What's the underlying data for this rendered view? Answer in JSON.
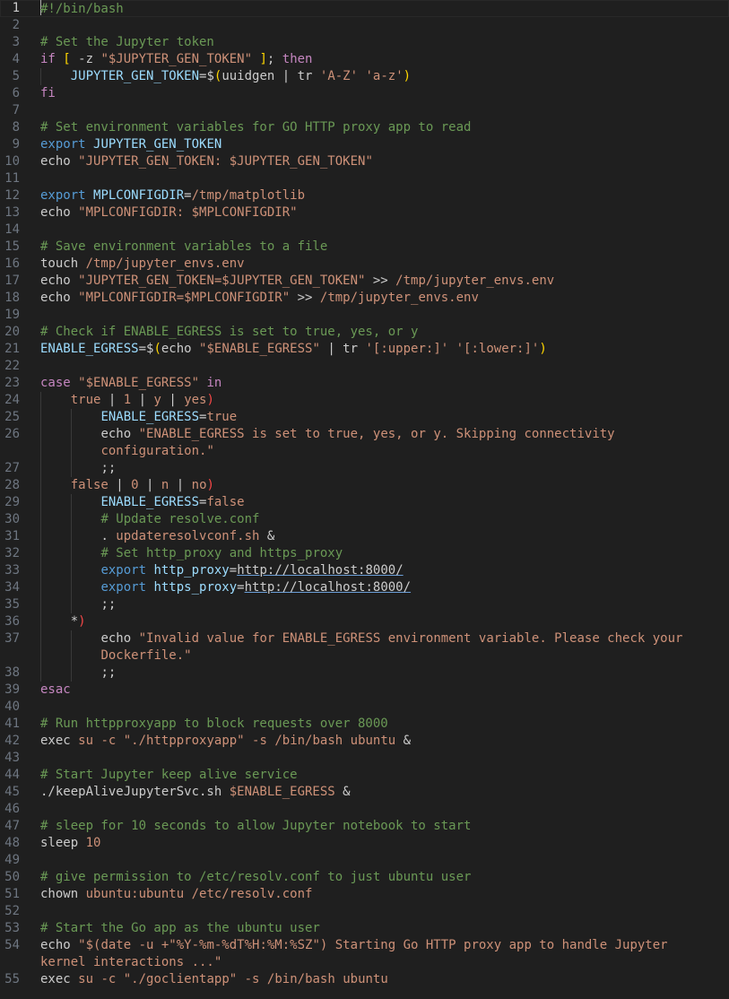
{
  "editor": {
    "current_line": 1,
    "lines": [
      {
        "n": "1",
        "indent": 0,
        "tokens": [
          [
            "comment",
            "#!/bin/bash"
          ]
        ]
      },
      {
        "n": "2",
        "indent": 0,
        "tokens": []
      },
      {
        "n": "3",
        "indent": 0,
        "tokens": [
          [
            "comment",
            "# Set the Jupyter token"
          ]
        ]
      },
      {
        "n": "4",
        "indent": 0,
        "tokens": [
          [
            "keyword",
            "if"
          ],
          [
            "plain",
            " "
          ],
          [
            "bracket",
            "["
          ],
          [
            "plain",
            " -z "
          ],
          [
            "string",
            "\"$JUPYTER_GEN_TOKEN\""
          ],
          [
            "plain",
            " "
          ],
          [
            "bracket",
            "]"
          ],
          [
            "plain",
            "; "
          ],
          [
            "keyword",
            "then"
          ]
        ]
      },
      {
        "n": "5",
        "indent": 1,
        "tokens": [
          [
            "var",
            "JUPYTER_GEN_TOKEN"
          ],
          [
            "plain",
            "=$"
          ],
          [
            "bracket",
            "("
          ],
          [
            "plain",
            "uuidgen | tr "
          ],
          [
            "string",
            "'A-Z'"
          ],
          [
            "plain",
            " "
          ],
          [
            "string",
            "'a-z'"
          ],
          [
            "bracket",
            ")"
          ]
        ]
      },
      {
        "n": "6",
        "indent": 0,
        "tokens": [
          [
            "keyword",
            "fi"
          ]
        ]
      },
      {
        "n": "7",
        "indent": 0,
        "tokens": []
      },
      {
        "n": "8",
        "indent": 0,
        "tokens": [
          [
            "comment",
            "# Set environment variables for GO HTTP proxy app to read"
          ]
        ]
      },
      {
        "n": "9",
        "indent": 0,
        "tokens": [
          [
            "builtin",
            "export"
          ],
          [
            "plain",
            " "
          ],
          [
            "var",
            "JUPYTER_GEN_TOKEN"
          ]
        ]
      },
      {
        "n": "10",
        "indent": 0,
        "tokens": [
          [
            "plain",
            "echo "
          ],
          [
            "string",
            "\"JUPYTER_GEN_TOKEN: $JUPYTER_GEN_TOKEN\""
          ]
        ]
      },
      {
        "n": "11",
        "indent": 0,
        "tokens": []
      },
      {
        "n": "12",
        "indent": 0,
        "tokens": [
          [
            "builtin",
            "export"
          ],
          [
            "plain",
            " "
          ],
          [
            "var",
            "MPLCONFIGDIR"
          ],
          [
            "plain",
            "="
          ],
          [
            "string",
            "/tmp/matplotlib"
          ]
        ]
      },
      {
        "n": "13",
        "indent": 0,
        "tokens": [
          [
            "plain",
            "echo "
          ],
          [
            "string",
            "\"MPLCONFIGDIR: $MPLCONFIGDIR\""
          ]
        ]
      },
      {
        "n": "14",
        "indent": 0,
        "tokens": []
      },
      {
        "n": "15",
        "indent": 0,
        "tokens": [
          [
            "comment",
            "# Save environment variables to a file"
          ]
        ]
      },
      {
        "n": "16",
        "indent": 0,
        "tokens": [
          [
            "plain",
            "touch "
          ],
          [
            "string",
            "/tmp/jupyter_envs.env"
          ]
        ]
      },
      {
        "n": "17",
        "indent": 0,
        "tokens": [
          [
            "plain",
            "echo "
          ],
          [
            "string",
            "\"JUPYTER_GEN_TOKEN=$JUPYTER_GEN_TOKEN\""
          ],
          [
            "plain",
            " >> "
          ],
          [
            "string",
            "/tmp/jupyter_envs.env"
          ]
        ]
      },
      {
        "n": "18",
        "indent": 0,
        "tokens": [
          [
            "plain",
            "echo "
          ],
          [
            "string",
            "\"MPLCONFIGDIR=$MPLCONFIGDIR\""
          ],
          [
            "plain",
            " >> "
          ],
          [
            "string",
            "/tmp/jupyter_envs.env"
          ]
        ]
      },
      {
        "n": "19",
        "indent": 0,
        "tokens": []
      },
      {
        "n": "20",
        "indent": 0,
        "tokens": [
          [
            "comment",
            "# Check if ENABLE_EGRESS is set to true, yes, or y"
          ]
        ]
      },
      {
        "n": "21",
        "indent": 0,
        "tokens": [
          [
            "var",
            "ENABLE_EGRESS"
          ],
          [
            "plain",
            "=$"
          ],
          [
            "bracket",
            "("
          ],
          [
            "plain",
            "echo "
          ],
          [
            "string",
            "\"$ENABLE_EGRESS\""
          ],
          [
            "plain",
            " | tr "
          ],
          [
            "string",
            "'[:upper:]'"
          ],
          [
            "plain",
            " "
          ],
          [
            "string",
            "'[:lower:]'"
          ],
          [
            "bracket",
            ")"
          ]
        ]
      },
      {
        "n": "22",
        "indent": 0,
        "tokens": []
      },
      {
        "n": "23",
        "indent": 0,
        "tokens": [
          [
            "keyword",
            "case"
          ],
          [
            "plain",
            " "
          ],
          [
            "string",
            "\"$ENABLE_EGRESS\""
          ],
          [
            "plain",
            " "
          ],
          [
            "keyword",
            "in"
          ]
        ]
      },
      {
        "n": "24",
        "indent": 1,
        "tokens": [
          [
            "string",
            "true"
          ],
          [
            "plain",
            " | "
          ],
          [
            "string",
            "1"
          ],
          [
            "plain",
            " | "
          ],
          [
            "string",
            "y"
          ],
          [
            "plain",
            " | "
          ],
          [
            "string",
            "yes"
          ],
          [
            "rparen",
            ")"
          ]
        ]
      },
      {
        "n": "25",
        "indent": 2,
        "tokens": [
          [
            "var",
            "ENABLE_EGRESS"
          ],
          [
            "plain",
            "="
          ],
          [
            "string",
            "true"
          ]
        ]
      },
      {
        "n": "26",
        "indent": 2,
        "tokens": [
          [
            "plain",
            "echo "
          ],
          [
            "string",
            "\"ENABLE_EGRESS is set to true, yes, or y. Skipping connectivity"
          ]
        ]
      },
      {
        "n": "",
        "indent": 2,
        "tokens": [
          [
            "string",
            "configuration.\""
          ]
        ]
      },
      {
        "n": "27",
        "indent": 2,
        "tokens": [
          [
            "plain",
            ";;"
          ]
        ]
      },
      {
        "n": "28",
        "indent": 1,
        "tokens": [
          [
            "string",
            "false"
          ],
          [
            "plain",
            " | "
          ],
          [
            "string",
            "0"
          ],
          [
            "plain",
            " | "
          ],
          [
            "string",
            "n"
          ],
          [
            "plain",
            " | "
          ],
          [
            "string",
            "no"
          ],
          [
            "rparen",
            ")"
          ]
        ]
      },
      {
        "n": "29",
        "indent": 2,
        "tokens": [
          [
            "var",
            "ENABLE_EGRESS"
          ],
          [
            "plain",
            "="
          ],
          [
            "string",
            "false"
          ]
        ]
      },
      {
        "n": "30",
        "indent": 2,
        "tokens": [
          [
            "comment",
            "# Update resolve.conf"
          ]
        ]
      },
      {
        "n": "31",
        "indent": 2,
        "tokens": [
          [
            "plain",
            ". "
          ],
          [
            "string",
            "updateresolvconf.sh"
          ],
          [
            "plain",
            " &"
          ]
        ]
      },
      {
        "n": "32",
        "indent": 2,
        "tokens": [
          [
            "comment",
            "# Set http_proxy and https_proxy"
          ]
        ]
      },
      {
        "n": "33",
        "indent": 2,
        "tokens": [
          [
            "builtin",
            "export"
          ],
          [
            "plain",
            " "
          ],
          [
            "var",
            "http_proxy"
          ],
          [
            "plain",
            "="
          ],
          [
            "url",
            "http://localhost:8000/"
          ]
        ]
      },
      {
        "n": "34",
        "indent": 2,
        "tokens": [
          [
            "builtin",
            "export"
          ],
          [
            "plain",
            " "
          ],
          [
            "var",
            "https_proxy"
          ],
          [
            "plain",
            "="
          ],
          [
            "url",
            "http://localhost:8000/"
          ]
        ]
      },
      {
        "n": "35",
        "indent": 2,
        "tokens": [
          [
            "plain",
            ";;"
          ]
        ]
      },
      {
        "n": "36",
        "indent": 1,
        "tokens": [
          [
            "plain",
            "*"
          ],
          [
            "rparen",
            ")"
          ]
        ]
      },
      {
        "n": "37",
        "indent": 2,
        "tokens": [
          [
            "plain",
            "echo "
          ],
          [
            "string",
            "\"Invalid value for ENABLE_EGRESS environment variable. Please check your"
          ]
        ]
      },
      {
        "n": "",
        "indent": 2,
        "tokens": [
          [
            "string",
            "Dockerfile.\""
          ]
        ]
      },
      {
        "n": "38",
        "indent": 2,
        "tokens": [
          [
            "plain",
            ";;"
          ]
        ]
      },
      {
        "n": "39",
        "indent": 0,
        "tokens": [
          [
            "keyword",
            "esac"
          ]
        ]
      },
      {
        "n": "40",
        "indent": 0,
        "tokens": []
      },
      {
        "n": "41",
        "indent": 0,
        "tokens": [
          [
            "comment",
            "# Run httpproxyapp to block requests over 8000"
          ]
        ]
      },
      {
        "n": "42",
        "indent": 0,
        "tokens": [
          [
            "plain",
            "exec "
          ],
          [
            "string",
            "su"
          ],
          [
            "plain",
            " "
          ],
          [
            "string",
            "-c"
          ],
          [
            "plain",
            " "
          ],
          [
            "string",
            "\"./httpproxyapp\""
          ],
          [
            "plain",
            " "
          ],
          [
            "string",
            "-s"
          ],
          [
            "plain",
            " "
          ],
          [
            "string",
            "/bin/bash"
          ],
          [
            "plain",
            " "
          ],
          [
            "string",
            "ubuntu"
          ],
          [
            "plain",
            " &"
          ]
        ]
      },
      {
        "n": "43",
        "indent": 0,
        "tokens": []
      },
      {
        "n": "44",
        "indent": 0,
        "tokens": [
          [
            "comment",
            "# Start Jupyter keep alive service"
          ]
        ]
      },
      {
        "n": "45",
        "indent": 0,
        "tokens": [
          [
            "plain",
            "./keepAliveJupyterSvc.sh "
          ],
          [
            "string",
            "$ENABLE_EGRESS"
          ],
          [
            "plain",
            " &"
          ]
        ]
      },
      {
        "n": "46",
        "indent": 0,
        "tokens": []
      },
      {
        "n": "47",
        "indent": 0,
        "tokens": [
          [
            "comment",
            "# sleep for 10 seconds to allow Jupyter notebook to start"
          ]
        ]
      },
      {
        "n": "48",
        "indent": 0,
        "tokens": [
          [
            "plain",
            "sleep "
          ],
          [
            "string",
            "10"
          ]
        ]
      },
      {
        "n": "49",
        "indent": 0,
        "tokens": []
      },
      {
        "n": "50",
        "indent": 0,
        "tokens": [
          [
            "comment",
            "# give permission to /etc/resolv.conf to just ubuntu user"
          ]
        ]
      },
      {
        "n": "51",
        "indent": 0,
        "tokens": [
          [
            "plain",
            "chown "
          ],
          [
            "string",
            "ubuntu:ubuntu"
          ],
          [
            "plain",
            " "
          ],
          [
            "string",
            "/etc/resolv.conf"
          ]
        ]
      },
      {
        "n": "52",
        "indent": 0,
        "tokens": []
      },
      {
        "n": "53",
        "indent": 0,
        "tokens": [
          [
            "comment",
            "# Start the Go app as the ubuntu user"
          ]
        ]
      },
      {
        "n": "54",
        "indent": 0,
        "tokens": [
          [
            "plain",
            "echo "
          ],
          [
            "string",
            "\"$(date -u +\"%Y-%m-%dT%H:%M:%SZ\") Starting Go HTTP proxy app to handle Jupyter"
          ]
        ]
      },
      {
        "n": "",
        "indent": 0,
        "tokens": [
          [
            "string",
            "kernel interactions ...\""
          ]
        ]
      },
      {
        "n": "55",
        "indent": 0,
        "tokens": [
          [
            "plain",
            "exec "
          ],
          [
            "string",
            "su"
          ],
          [
            "plain",
            " "
          ],
          [
            "string",
            "-c"
          ],
          [
            "plain",
            " "
          ],
          [
            "string",
            "\"./goclientapp\""
          ],
          [
            "plain",
            " "
          ],
          [
            "string",
            "-s"
          ],
          [
            "plain",
            " "
          ],
          [
            "string",
            "/bin/bash"
          ],
          [
            "plain",
            " "
          ],
          [
            "string",
            "ubuntu"
          ]
        ]
      }
    ]
  }
}
